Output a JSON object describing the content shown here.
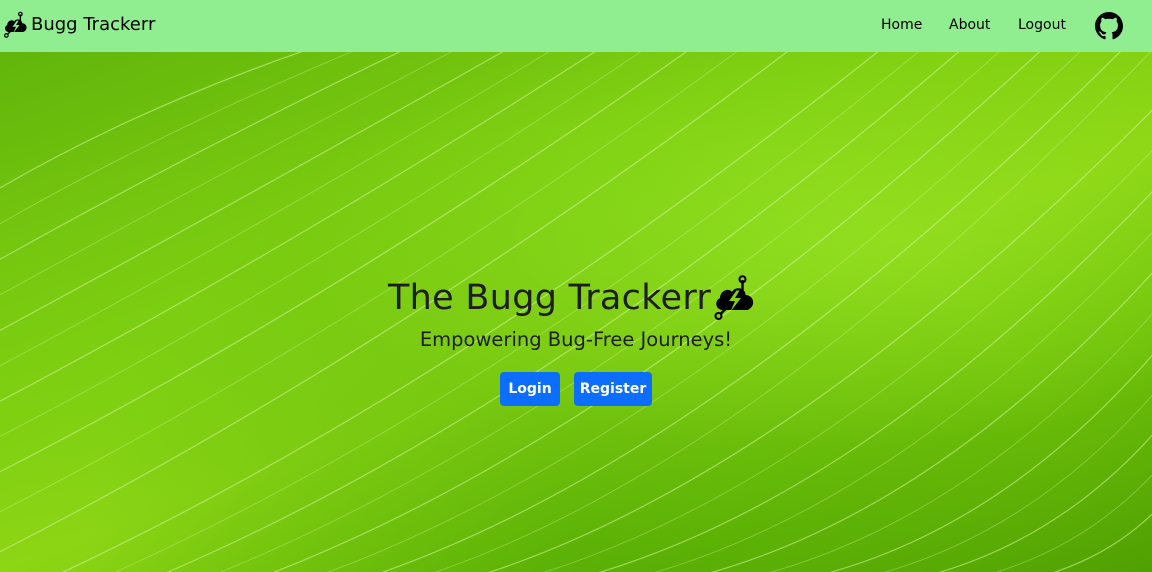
{
  "navbar": {
    "brand_icon": "bug-cloud-icon",
    "brand_text": "Bugg Trackerr",
    "links": {
      "home": "Home",
      "about": "About",
      "logout": "Logout"
    },
    "github_icon": "github-icon",
    "background": "#90ee90"
  },
  "hero": {
    "title": "The Bugg Trackerr",
    "title_icon": "bug-cloud-icon",
    "subtitle": "Empowering Bug-Free Journeys!",
    "background_image": "green leaf texture",
    "buttons": {
      "login": "Login",
      "register": "Register"
    },
    "button_color": "#0d6efd"
  }
}
